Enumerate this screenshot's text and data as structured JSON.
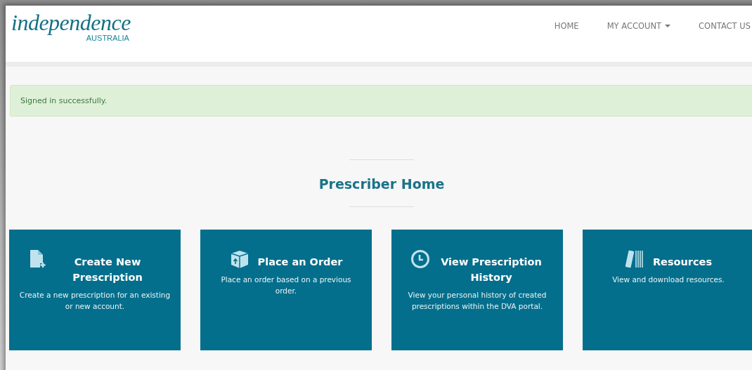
{
  "header": {
    "logo": {
      "name": "independence",
      "sub": "AUSTRALIA"
    },
    "nav": [
      {
        "label": "HOME",
        "dropdown": false
      },
      {
        "label": "MY ACCOUNT",
        "dropdown": true
      },
      {
        "label": "CONTACT US",
        "dropdown": false
      }
    ]
  },
  "alert": {
    "message": "Signed in successfully."
  },
  "title": "Prescriber Home",
  "cards": [
    {
      "title": "Create New Prescription",
      "description": "Create a new prescription for an existing or new account."
    },
    {
      "title": "Place an Order",
      "description": "Place an order based on a previous order."
    },
    {
      "title": "View Prescription History",
      "description": "View your personal history of created prescriptions within the DVA portal."
    },
    {
      "title": "Resources",
      "description": "View and download resources."
    }
  ]
}
